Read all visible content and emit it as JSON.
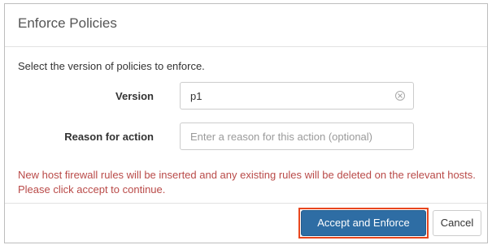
{
  "dialog": {
    "title": "Enforce Policies",
    "intro": "Select the version of policies to enforce.",
    "version": {
      "label": "Version",
      "value": "p1"
    },
    "reason": {
      "label": "Reason for action",
      "placeholder": "Enter a reason for this action (optional)",
      "value": ""
    },
    "warning": "New host firewall rules will be inserted and any existing rules will be deleted on the relevant hosts. Please click accept to continue.",
    "buttons": {
      "accept": "Accept and Enforce",
      "cancel": "Cancel"
    },
    "colors": {
      "primary": "#2e6da4",
      "warning_text": "#b94a48",
      "highlight": "#e8461e"
    },
    "icons": {
      "clear": "clear-circle-icon"
    }
  }
}
